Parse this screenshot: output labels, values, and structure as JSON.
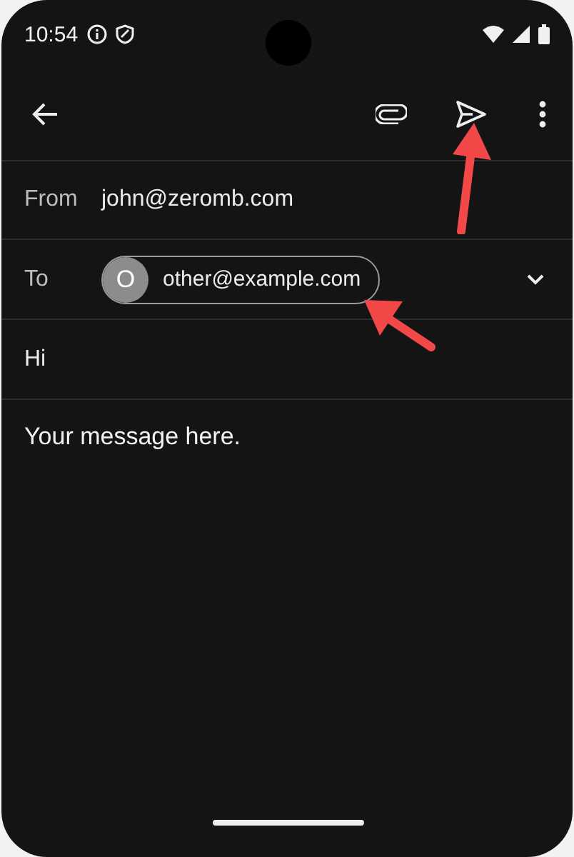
{
  "status_bar": {
    "time": "10:54"
  },
  "from": {
    "label": "From",
    "value": "john@zeromb.com"
  },
  "to": {
    "label": "To",
    "chips": [
      {
        "initial": "O",
        "email": "other@example.com"
      }
    ]
  },
  "subject": {
    "value": "Hi"
  },
  "body": {
    "value": "Your message here."
  }
}
